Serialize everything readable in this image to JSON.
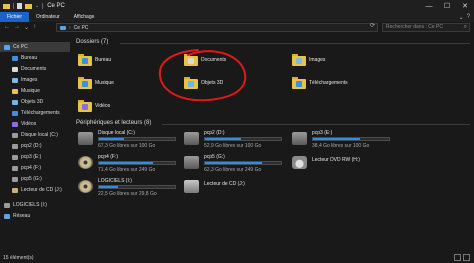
{
  "window": {
    "title": "Ce PC",
    "controls": {
      "minimize": "—",
      "maximize": "☐",
      "close": "✕"
    }
  },
  "ribbon": {
    "tabs": [
      "Fichier",
      "Ordinateur",
      "Affichage"
    ],
    "expand_glyph": "⌄",
    "help_glyph": "?"
  },
  "address_bar": {
    "back": "←",
    "forward": "→",
    "recent": "⌄",
    "up": "↑",
    "path": "Ce PC",
    "refresh": "⟳",
    "search_placeholder": "Rechercher dans : Ce PC",
    "search_glyph": "⌕"
  },
  "sidebar": {
    "items": [
      {
        "label": "Ce PC",
        "icon": "pc-icon",
        "color": "#5ba3e6"
      },
      {
        "label": "Bureau",
        "icon": "desktop-icon",
        "color": "#3d8fe0"
      },
      {
        "label": "Documents",
        "icon": "documents-icon",
        "color": "#d9d9d9"
      },
      {
        "label": "Images",
        "icon": "pictures-icon",
        "color": "#7fb8e8"
      },
      {
        "label": "Musique",
        "icon": "music-icon",
        "color": "#e8c34a"
      },
      {
        "label": "Objets 3D",
        "icon": "objects-3d-icon",
        "color": "#6cb6e8"
      },
      {
        "label": "Téléchargements",
        "icon": "downloads-icon",
        "color": "#3d8fe0"
      },
      {
        "label": "Vidéos",
        "icon": "videos-icon",
        "color": "#8a6de0"
      },
      {
        "label": "Disque local (C:)",
        "icon": "drive-icon",
        "color": "#9a9a9a"
      },
      {
        "label": "pcp2 (D:)",
        "icon": "drive-icon",
        "color": "#9a9a9a"
      },
      {
        "label": "pcp3 (E:)",
        "icon": "drive-icon",
        "color": "#9a9a9a"
      },
      {
        "label": "pcp4 (F:)",
        "icon": "drive-icon",
        "color": "#9a9a9a"
      },
      {
        "label": "pcp5 (G:)",
        "icon": "drive-icon",
        "color": "#9a9a9a"
      },
      {
        "label": "Lecteur de CD (J:)",
        "icon": "cd-icon",
        "color": "#c9b27a"
      },
      {
        "label": "LOGICIELS (I:)",
        "icon": "drive-icon",
        "color": "#9a9a9a"
      },
      {
        "label": "Réseau",
        "icon": "network-icon",
        "color": "#5ba3e6"
      }
    ]
  },
  "folders": {
    "title": "Dossiers (7)",
    "items": [
      {
        "label": "Bureau",
        "icon": "desktop-folder-icon",
        "color": "#3d8fe0"
      },
      {
        "label": "Documents",
        "icon": "documents-folder-icon",
        "color": "#d9d9d9"
      },
      {
        "label": "Images",
        "icon": "pictures-folder-icon",
        "color": "#7fb8e8"
      },
      {
        "label": "Musique",
        "icon": "music-folder-icon",
        "color": "#3d8fe0"
      },
      {
        "label": "Objets 3D",
        "icon": "objects-3d-folder-icon",
        "color": "#6cb6e8"
      },
      {
        "label": "Téléchargements",
        "icon": "downloads-folder-icon",
        "color": "#3d8fe0"
      },
      {
        "label": "Vidéos",
        "icon": "videos-folder-icon",
        "color": "#8a6de0"
      }
    ]
  },
  "devices": {
    "title": "Périphériques et lecteurs (8)",
    "items": [
      {
        "label": "Disque local (C:)",
        "free": "67,3 Go libres sur 100 Go",
        "used_fraction": 0.33,
        "kind": "hdd"
      },
      {
        "label": "pcp2 (D:)",
        "free": "52,9 Go libres sur 100 Go",
        "used_fraction": 0.47,
        "kind": "hdd"
      },
      {
        "label": "pcp3 (E:)",
        "free": "38,4 Go libres sur 100 Go",
        "used_fraction": 0.62,
        "kind": "hdd"
      },
      {
        "label": "pcp4 (F:)",
        "free": "71,4 Go libres sur 249 Go",
        "used_fraction": 0.71,
        "kind": "hdd"
      },
      {
        "label": "pcp5 (G:)",
        "free": "62,3 Go libres sur 249 Go",
        "used_fraction": 0.75,
        "kind": "hdd"
      },
      {
        "label": "Lecteur DVD RW (H:)",
        "free": "",
        "used_fraction": null,
        "kind": "dvd"
      },
      {
        "label": "LOGICIELS (I:)",
        "free": "22,5 Go libres sur 29,8 Go",
        "used_fraction": 0.25,
        "kind": "hdd"
      },
      {
        "label": "Lecteur de CD (J:)",
        "free": "",
        "used_fraction": null,
        "kind": "cd"
      }
    ]
  },
  "status": {
    "text": "15 élément(s)"
  },
  "colors": {
    "accent": "#1a64c9",
    "bar_fill": "#2f8ee0",
    "annotation": "#e01818"
  }
}
